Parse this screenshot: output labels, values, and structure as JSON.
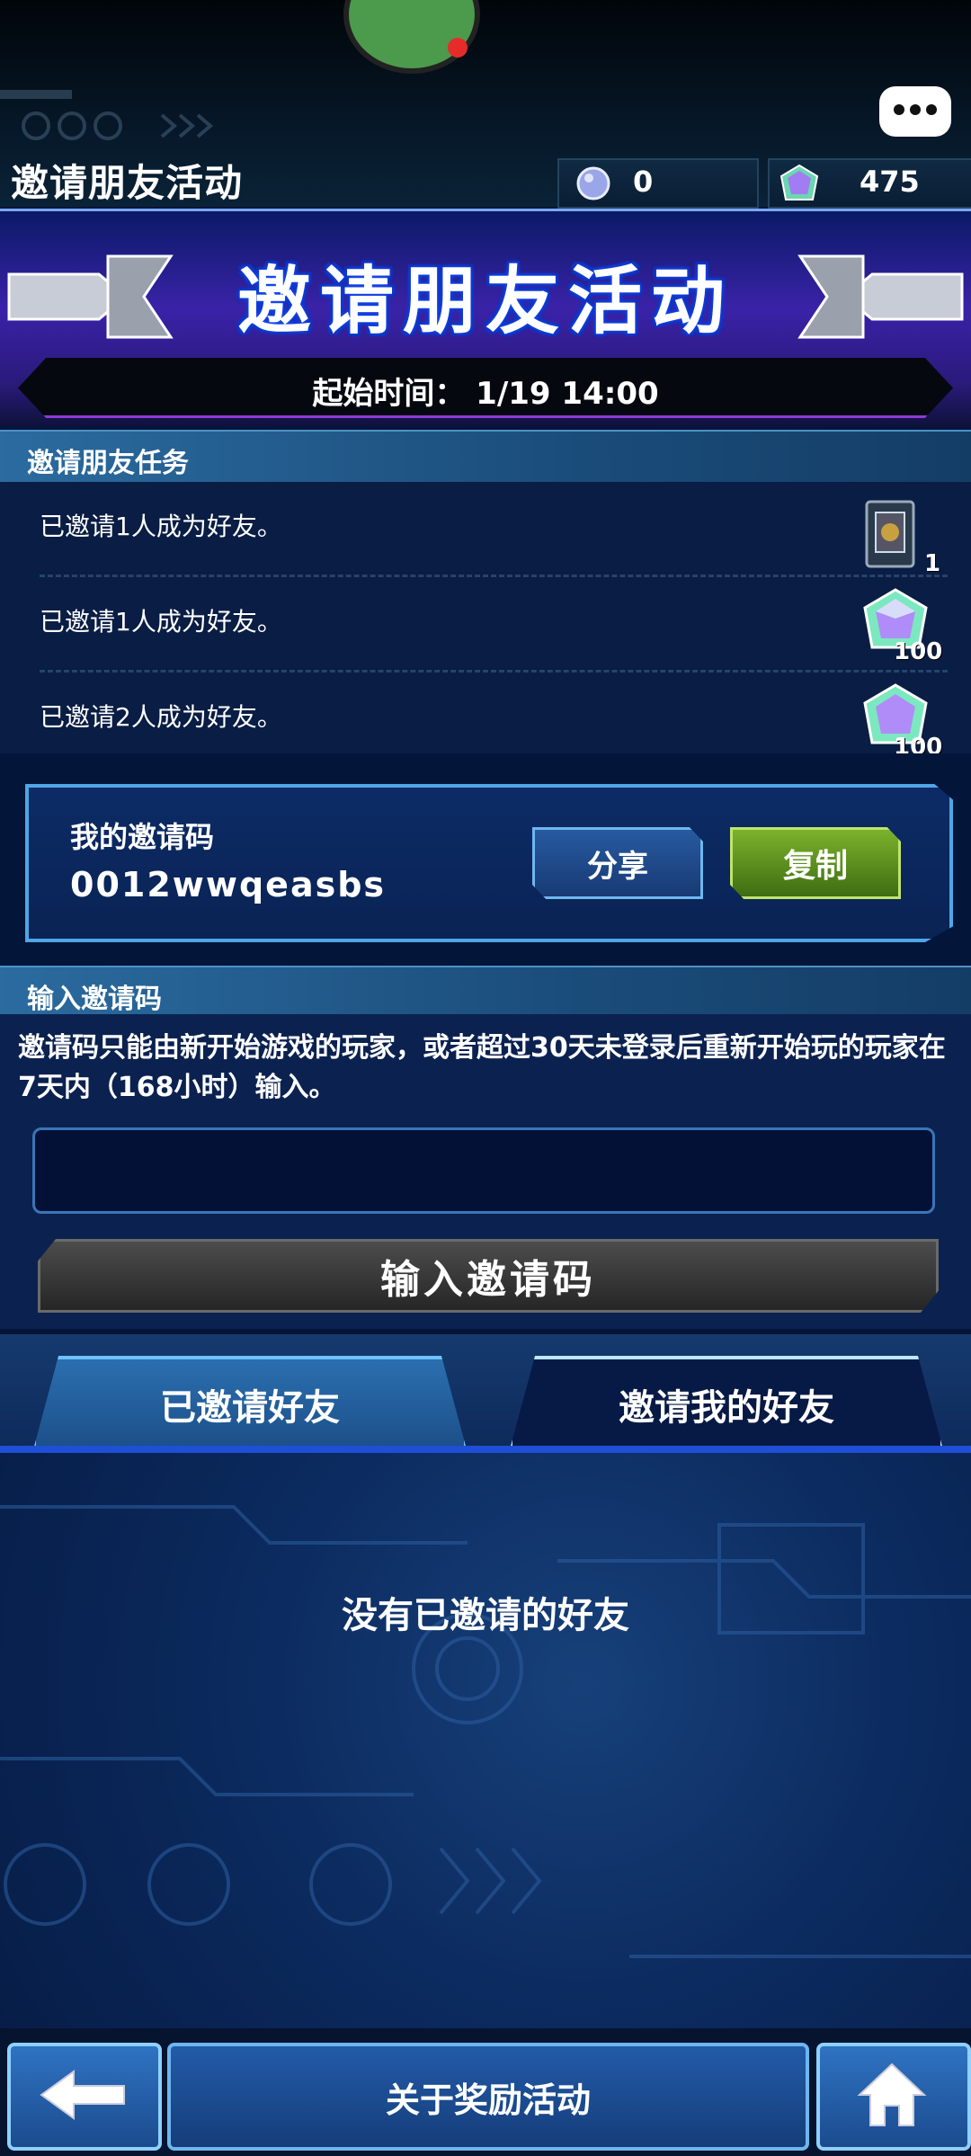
{
  "header": {
    "title": "邀请朋友活动",
    "currency_orbs": "0",
    "currency_gems": "475"
  },
  "banner": {
    "title": "邀请朋友活动",
    "start_time": "起始时间： 1/19 14:00"
  },
  "tasks": {
    "header": "邀请朋友任务",
    "items": [
      {
        "text": "已邀请1人成为好友。",
        "reward_icon": "card-pack-icon",
        "reward_count": "1"
      },
      {
        "text": "已邀请1人成为好友。",
        "reward_icon": "gem-icon",
        "reward_count": "100"
      },
      {
        "text": "已邀请2人成为好友。",
        "reward_icon": "gem-icon",
        "reward_count": "100"
      }
    ]
  },
  "my_code": {
    "label": "我的邀请码",
    "value": "0012wwqeasbs",
    "share_label": "分享",
    "copy_label": "复制"
  },
  "enter_code": {
    "header": "输入邀请码",
    "description": "邀请码只能由新开始游戏的玩家，或者超过30天未登录后重新开始玩的玩家在7天内（168小时）输入。",
    "input_value": "",
    "submit_label": "输入邀请码"
  },
  "tabs": [
    {
      "label": "已邀请好友"
    },
    {
      "label": "邀请我的好友"
    }
  ],
  "list": {
    "empty_text": "没有已邀请的好友"
  },
  "bottom": {
    "about_label": "关于奖励活动"
  },
  "colors": {
    "accent_blue": "#4fa6e6",
    "copy_green": "#7bb22c",
    "notification_red": "#e62b2b"
  }
}
